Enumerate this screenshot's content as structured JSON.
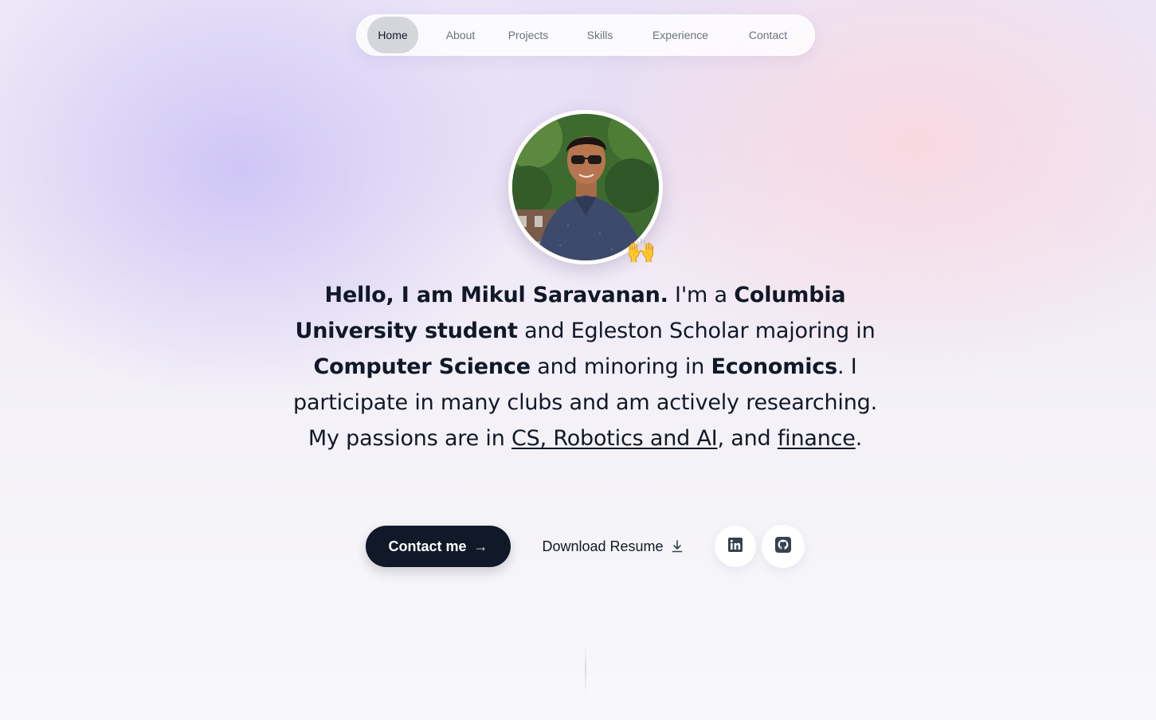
{
  "nav": {
    "items": [
      {
        "label": "Home",
        "active": true
      },
      {
        "label": "About",
        "active": false
      },
      {
        "label": "Projects",
        "active": false
      },
      {
        "label": "Skills",
        "active": false
      },
      {
        "label": "Experience",
        "active": false
      },
      {
        "label": "Contact",
        "active": false
      }
    ]
  },
  "hero": {
    "avatar_alt": "profile photo",
    "emoji": "🙌",
    "intro": {
      "greeting": "Hello, I am Mikul Saravanan.",
      "t1": " I'm a ",
      "school": "Columbia University student",
      "t2": " and Egleston Scholar majoring in ",
      "major": "Computer Science",
      "t3": " and minoring in ",
      "minor": "Economics",
      "t4": ". I participate in many clubs and am actively researching. My passions are in ",
      "link1": "CS, Robotics and AI",
      "t5": ", and ",
      "link2": "finance",
      "t6": "."
    }
  },
  "actions": {
    "contact_label": "Contact me",
    "contact_icon": "arrow-right-icon",
    "resume_label": "Download Resume",
    "resume_icon": "download-icon",
    "linkedin_icon": "linkedin-icon",
    "github_icon": "github-icon"
  },
  "colors": {
    "primary": "#111827",
    "muted_text": "#6b7280",
    "nav_active_bg": "#d4d6dc"
  }
}
